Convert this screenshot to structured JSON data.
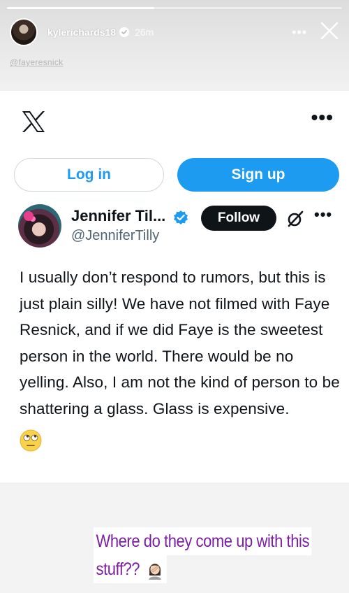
{
  "story": {
    "progress_fraction": 0.44,
    "username": "kylerichards18",
    "timestamp": "26m",
    "menu_icon": "more-horizontal-icon",
    "close_icon": "close-icon",
    "mention": "@fayeresnick"
  },
  "tweet_card": {
    "logo": "x-logo-icon",
    "menu_icon": "more-horizontal-icon",
    "login_label": "Log in",
    "signup_label": "Sign up",
    "author": {
      "name": "Jennifer Til...",
      "handle": "@JenniferTilly",
      "verified": true
    },
    "follow_label": "Follow",
    "grok_icon": "grok-icon",
    "text": "I usually don’t respond to rumors, but this is just plain silly! We have not filmed with Faye Resnick, and if we did  Faye is the sweetest person in the world. There would be no yelling. Also, I am not the kind of person to be shattering a glass. Glass is expensive.",
    "emoji": "eye-roll-emoji-icon"
  },
  "caption": {
    "line1": "Where do they come up with this",
    "line2": "stuff??"
  },
  "colors": {
    "twitter_blue": "#1d9bf0",
    "black": "#0f1419",
    "gray_text": "#536471",
    "caption_purple": "#7b1fa2"
  }
}
